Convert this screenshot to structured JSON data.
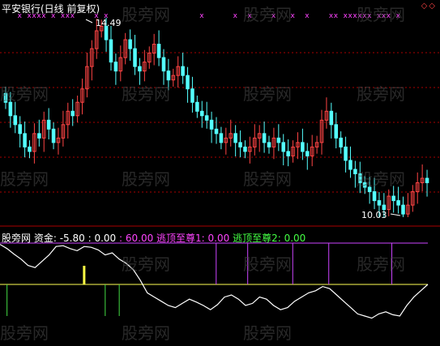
{
  "header": {
    "title": "平安银行(日线 前复权)"
  },
  "watermark": "股旁网",
  "price_labels": {
    "high": "14.49",
    "low": "10.03"
  },
  "indicator": {
    "name": "股旁网",
    "fund_label": "资金: -5.80",
    "value1": ": 0.00",
    "value2": ": 60.00",
    "escape1": "逃顶至尊1: 0.00",
    "escape2": "逃顶至尊2: 0.00"
  },
  "colors": {
    "background": "#000000",
    "up_candle": "#ff4444",
    "down_candle": "#54ffff",
    "grid": "#aa0000",
    "signal_x": "#ff44ff",
    "indicator_line": "#ffffff",
    "ref_line_yellow": "#ffff55",
    "ref_line_magenta": "#cc44ff",
    "bar_green": "#44dd44",
    "bar_magenta": "#cc44ff",
    "bar_yellow": "#ffff44"
  },
  "chart_data": {
    "type": "candlestick",
    "price_closes": [
      12.6,
      12.3,
      12.1,
      11.9,
      11.6,
      11.5,
      11.9,
      11.8,
      12.2,
      12.0,
      11.7,
      11.8,
      12.1,
      12.4,
      12.3,
      12.6,
      12.9,
      13.4,
      13.8,
      14.2,
      14.3,
      14.0,
      13.5,
      13.3,
      13.6,
      14.0,
      13.8,
      13.4,
      13.3,
      13.5,
      13.7,
      13.9,
      13.6,
      13.3,
      13.1,
      13.2,
      13.4,
      13.2,
      12.9,
      12.6,
      12.4,
      12.3,
      12.2,
      12.0,
      11.9,
      11.7,
      11.8,
      11.9,
      11.7,
      11.6,
      11.5,
      11.6,
      11.8,
      11.9,
      11.7,
      11.6,
      11.8,
      11.7,
      11.5,
      11.4,
      11.6,
      11.7,
      11.5,
      11.4,
      11.6,
      11.7,
      12.2,
      12.4,
      12.1,
      11.8,
      11.6,
      11.3,
      11.1,
      11.0,
      10.8,
      10.7,
      10.6,
      10.4,
      10.3,
      10.2,
      10.5,
      10.4,
      10.3,
      10.1,
      10.3,
      10.6,
      10.8,
      10.9,
      10.8
    ],
    "high": 14.49,
    "low": 10.03,
    "signal_x_marks": [
      3,
      5,
      6,
      7,
      8,
      10,
      12,
      13,
      14,
      19,
      21,
      41,
      48,
      51,
      56,
      60,
      63,
      68,
      69,
      71,
      72,
      73,
      74,
      75,
      76,
      78,
      79,
      80,
      82
    ],
    "indicator": [
      0.95,
      0.85,
      0.72,
      0.6,
      0.45,
      0.4,
      0.55,
      0.7,
      0.9,
      0.92,
      0.85,
      0.8,
      0.9,
      0.88,
      0.82,
      0.7,
      0.75,
      0.6,
      0.5,
      0.35,
      0.1,
      -0.2,
      -0.3,
      -0.4,
      -0.5,
      -0.55,
      -0.45,
      -0.35,
      -0.42,
      -0.5,
      -0.6,
      -0.48,
      -0.3,
      -0.25,
      -0.35,
      -0.5,
      -0.45,
      -0.3,
      -0.35,
      -0.5,
      -0.6,
      -0.55,
      -0.4,
      -0.3,
      -0.2,
      -0.15,
      -0.05,
      -0.1,
      -0.25,
      -0.4,
      -0.55,
      -0.7,
      -0.75,
      -0.8,
      -0.7,
      -0.65,
      -0.72,
      -0.75,
      -0.5,
      -0.3,
      -0.15,
      0.0
    ],
    "green_bars": [
      1,
      15,
      17
    ],
    "yellow_bars": [
      12
    ],
    "magenta_bars": [
      48,
      55,
      65,
      73,
      87
    ]
  }
}
